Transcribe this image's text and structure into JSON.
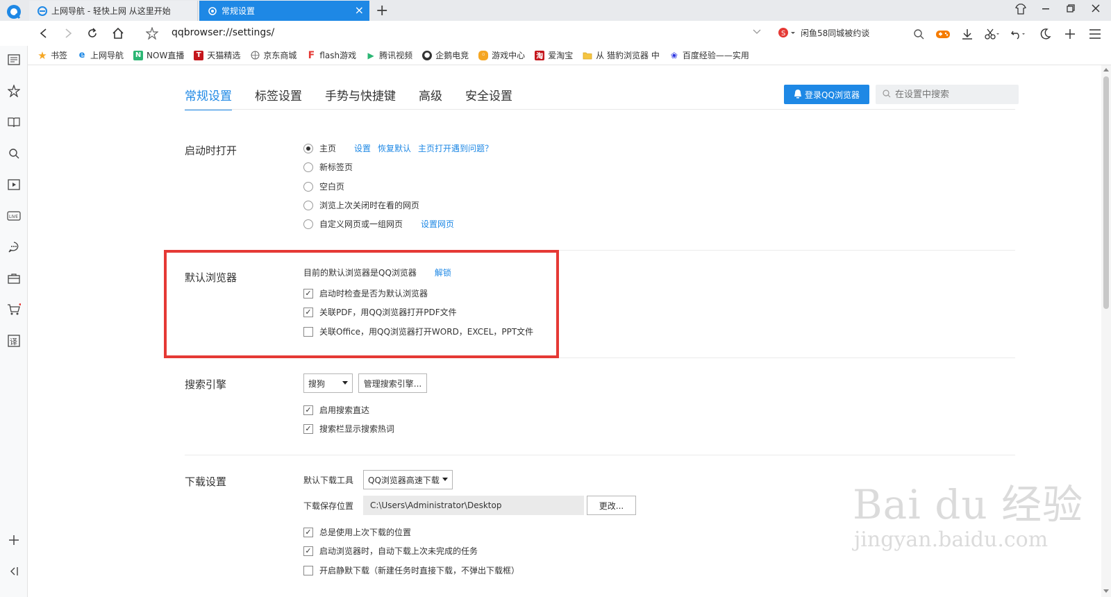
{
  "tabs": [
    {
      "label": "上网导航 - 轻快上网 从这里开始",
      "active": false
    },
    {
      "label": "常规设置",
      "active": true
    }
  ],
  "address": {
    "url": "qqbrowser://settings/",
    "search_hint": "闲鱼58同城被约谈"
  },
  "bookmarks": [
    {
      "label": "书签",
      "icon": "star-icon",
      "color": "#f5a623"
    },
    {
      "label": "上网导航",
      "icon": "e-icon",
      "color": "#1e88e5"
    },
    {
      "label": "NOW直播",
      "icon": "now-icon",
      "color": "#2bb673"
    },
    {
      "label": "天猫精选",
      "icon": "tmall-icon",
      "color": "#c4161c"
    },
    {
      "label": "京东商城",
      "icon": "globe-icon",
      "color": "#666666"
    },
    {
      "label": "flash游戏",
      "icon": "flash-icon",
      "color": "#e53935"
    },
    {
      "label": "腾讯视频",
      "icon": "play-icon",
      "color": "#2bb673"
    },
    {
      "label": "企鹅电竞",
      "icon": "penguin-icon",
      "color": "#333333"
    },
    {
      "label": "游戏中心",
      "icon": "game-icon",
      "color": "#f5a623"
    },
    {
      "label": "爱淘宝",
      "icon": "taobao-icon",
      "color": "#c4161c"
    },
    {
      "label": "从 猎豹浏览器 中",
      "icon": "folder-icon",
      "color": "#f5c542"
    },
    {
      "label": "百度经验——实用",
      "icon": "paw-icon",
      "color": "#2932e1"
    }
  ],
  "settings_nav": [
    "常规设置",
    "标签设置",
    "手势与快捷键",
    "高级",
    "安全设置"
  ],
  "login_button": "登录QQ浏览器",
  "settings_search_placeholder": "在设置中搜索",
  "startup": {
    "title": "启动时打开",
    "options": [
      "主页",
      "新标签页",
      "空白页",
      "浏览上次关闭时在看的网页",
      "自定义网页或一组网页"
    ],
    "selected": 0,
    "links": [
      "设置",
      "恢复默认",
      "主页打开遇到问题？"
    ],
    "custom_link": "设置网页"
  },
  "default_browser": {
    "title": "默认浏览器",
    "status": "目前的默认浏览器是QQ浏览器",
    "unlock": "解锁",
    "options": [
      {
        "label": "启动时检查是否为默认浏览器",
        "checked": true
      },
      {
        "label": "关联PDF，用QQ浏览器打开PDF文件",
        "checked": true
      },
      {
        "label": "关联Office，用QQ浏览器打开WORD，EXCEL，PPT文件",
        "checked": false
      }
    ]
  },
  "search_engine": {
    "title": "搜索引擎",
    "selected": "搜狗",
    "manage": "管理搜索引擎...",
    "options": [
      {
        "label": "启用搜索直达",
        "checked": true
      },
      {
        "label": "搜索栏显示搜索热词",
        "checked": true
      }
    ]
  },
  "download": {
    "title": "下载设置",
    "tool_label": "默认下载工具",
    "tool_value": "QQ浏览器高速下载",
    "path_label": "下载保存位置",
    "path_value": "C:\\Users\\Administrator\\Desktop",
    "change": "更改...",
    "options": [
      {
        "label": "总是使用上次下载的位置",
        "checked": true
      },
      {
        "label": "启动浏览器时，自动下载上次未完成的任务",
        "checked": true
      },
      {
        "label": "开启静默下载（新建任务时直接下载，不弹出下载框）",
        "checked": false
      }
    ]
  },
  "watermark": {
    "brand": "Bai du 经验",
    "site": "jingyan.baidu.com"
  },
  "colors": {
    "accent": "#1e88e5",
    "highlight_box": "#e53935"
  }
}
